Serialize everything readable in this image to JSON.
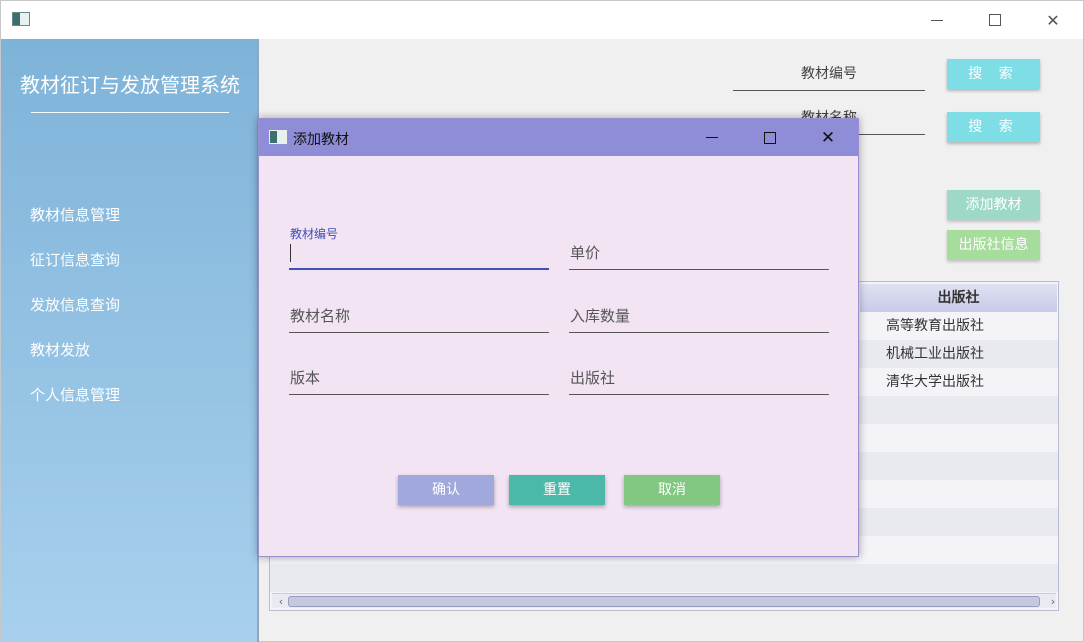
{
  "sidebar": {
    "title": "教材征订与发放管理系统",
    "items": [
      {
        "label": "教材信息管理"
      },
      {
        "label": "征订信息查询"
      },
      {
        "label": "发放信息查询"
      },
      {
        "label": "教材发放"
      },
      {
        "label": "个人信息管理"
      }
    ]
  },
  "search": {
    "field1_label": "教材编号",
    "field2_label": "教材名称",
    "button_label": "搜 索"
  },
  "actions": {
    "add_label": "添加教材",
    "publisher_label": "出版社信息"
  },
  "table": {
    "columns": [
      "出版社"
    ],
    "rows": [
      {
        "publisher": "高等教育出版社"
      },
      {
        "publisher": "机械工业出版社"
      },
      {
        "publisher": "清华大学出版社"
      }
    ]
  },
  "dialog": {
    "title": "添加教材",
    "fields": {
      "code": "教材编号",
      "price": "单价",
      "name": "教材名称",
      "stock": "入库数量",
      "edition": "版本",
      "publisher": "出版社"
    },
    "buttons": {
      "confirm": "确认",
      "reset": "重置",
      "cancel": "取消"
    }
  }
}
